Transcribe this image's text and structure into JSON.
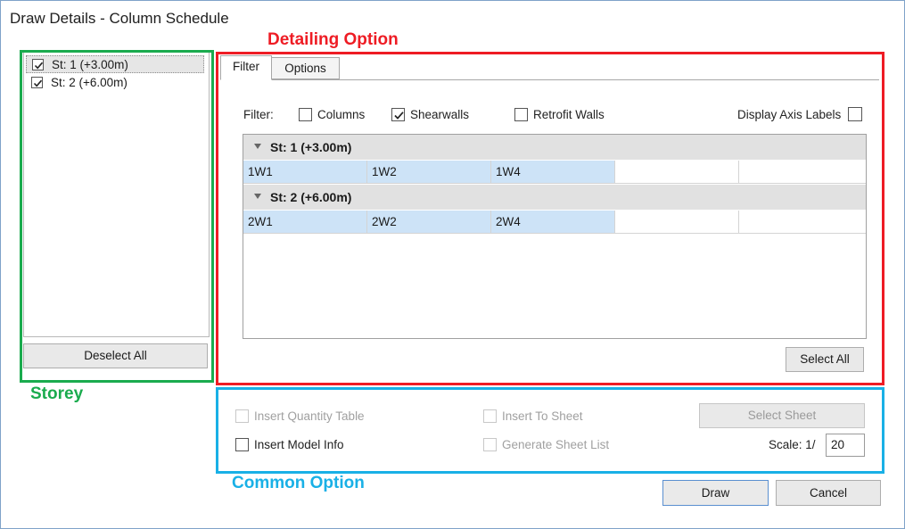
{
  "window": {
    "title": "Draw Details - Column Schedule"
  },
  "annotations": {
    "detailing": "Detailing Option",
    "storey": "Storey",
    "common": "Common Option",
    "colors": {
      "storey": "#1aab4e",
      "detailing": "#ee1c24",
      "common": "#19b0e6"
    }
  },
  "storey_panel": {
    "items": [
      {
        "label": "St: 1 (+3.00m)",
        "checked": true,
        "selected": true
      },
      {
        "label": "St: 2 (+6.00m)",
        "checked": true,
        "selected": false
      }
    ],
    "deselect_label": "Deselect All"
  },
  "tabs": [
    {
      "label": "Filter",
      "active": true
    },
    {
      "label": "Options",
      "active": false
    }
  ],
  "filter": {
    "label": "Filter:",
    "columns": {
      "label": "Columns",
      "checked": false
    },
    "shearwalls": {
      "label": "Shearwalls",
      "checked": true
    },
    "retrofit": {
      "label": "Retrofit Walls",
      "checked": false
    },
    "axis_labels": {
      "label": "Display Axis Labels",
      "checked": false
    }
  },
  "grid": {
    "groups": [
      {
        "label": "St: 1 (+3.00m)",
        "cells": [
          "1W1",
          "1W2",
          "1W4",
          "",
          ""
        ]
      },
      {
        "label": "St: 2 (+6.00m)",
        "cells": [
          "2W1",
          "2W2",
          "2W4",
          "",
          ""
        ]
      }
    ]
  },
  "select_all_label": "Select All",
  "common": {
    "insert_quantity_table": {
      "label": "Insert Quantity Table",
      "checked": false,
      "enabled": false
    },
    "insert_model_info": {
      "label": "Insert Model Info",
      "checked": false,
      "enabled": true
    },
    "insert_to_sheet": {
      "label": "Insert To Sheet",
      "checked": false,
      "enabled": false
    },
    "generate_sheet_list": {
      "label": "Generate Sheet List",
      "checked": false,
      "enabled": false
    },
    "select_sheet_label": "Select Sheet",
    "scale_label": "Scale: 1/",
    "scale_value": "20"
  },
  "footer": {
    "draw_label": "Draw",
    "cancel_label": "Cancel"
  }
}
